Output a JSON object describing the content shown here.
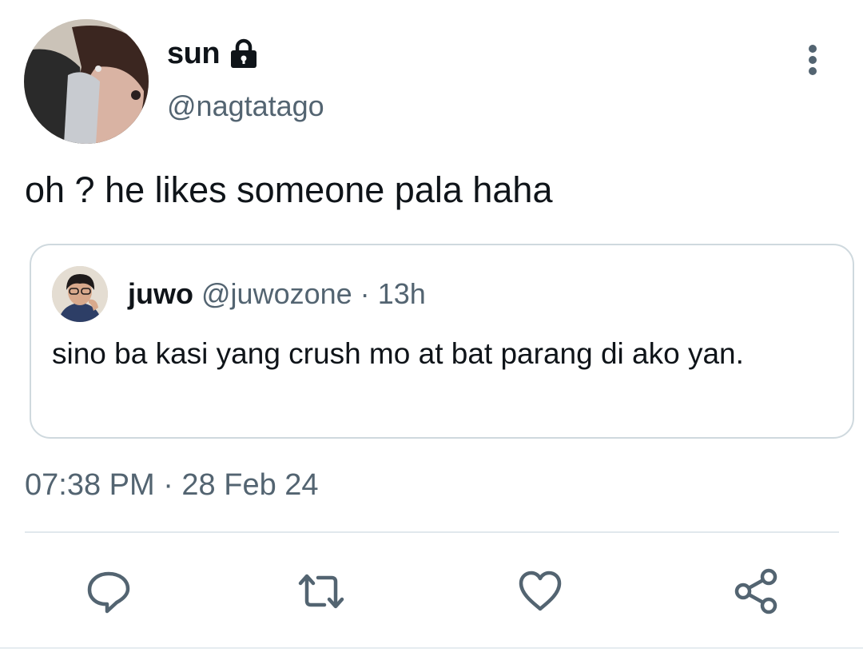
{
  "tweet": {
    "author": {
      "display_name": "sun",
      "handle": "@nagtatago",
      "protected_icon": "lock-icon"
    },
    "text": "oh ? he likes someone pala haha",
    "quoted_tweet": {
      "display_name": "juwo",
      "handle": "@juwozone",
      "separator": "·",
      "time_ago": "13h",
      "text": "sino ba kasi yang crush mo at bat parang di ako yan."
    },
    "timestamp": "07:38 PM · 28 Feb 24"
  },
  "menu": {
    "icon": "more-vertical-icon"
  },
  "actions": [
    {
      "icon": "reply-icon"
    },
    {
      "icon": "retweet-icon"
    },
    {
      "icon": "like-icon"
    },
    {
      "icon": "share-icon"
    }
  ],
  "colors": {
    "text_primary": "#0f1419",
    "text_secondary": "#536471",
    "border": "#cfd9de",
    "icon": "#536471"
  }
}
